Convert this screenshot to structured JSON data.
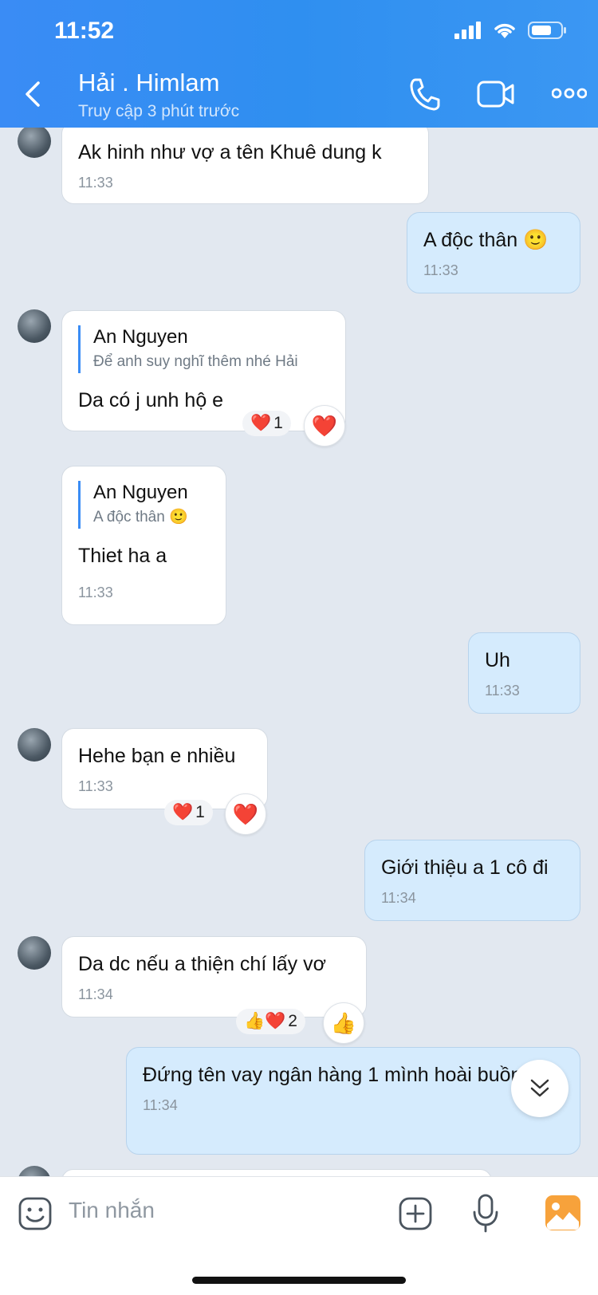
{
  "status": {
    "time": "11:52"
  },
  "header": {
    "title": "Hải . Himlam",
    "subtitle": "Truy cập 3 phút trước"
  },
  "messages": [
    {
      "text": "Ak hinh như vợ a tên Khuê dung k",
      "time": "11:33"
    },
    {
      "text": "A độc thân",
      "time": "11:33",
      "emoji": "🙂"
    },
    {
      "quote_name": "An Nguyen",
      "quote_text": "Để anh suy nghĩ thêm nhé Hải",
      "text": "Da có j unh hộ e",
      "reaction_count": "1",
      "reaction": "❤️"
    },
    {
      "quote_name": "An Nguyen",
      "quote_text": "A độc thân",
      "quote_emoji": "🙂",
      "text": "Thiet ha a",
      "time": "11:33"
    },
    {
      "text": "Uh",
      "time": "11:33"
    },
    {
      "text": "Hehe bạn e nhiều",
      "time": "11:33",
      "reaction_count": "1",
      "reaction": "❤️"
    },
    {
      "text": "Giới thiệu a 1 cô đi",
      "time": "11:34"
    },
    {
      "text": "Da dc nếu a thiện chí lấy vơ",
      "time": "11:34",
      "reaction_count": "2",
      "reaction_pill": "👍❤️",
      "reaction": "👍"
    },
    {
      "text": "Đứng tên vay ngân hàng 1 mình hoài buồn quá",
      "time": "11:34"
    }
  ],
  "input": {
    "placeholder": "Tin nhắn"
  },
  "icons": [
    "back-icon",
    "phone-icon",
    "video-call-icon",
    "more-icon",
    "sticker-icon",
    "add-icon",
    "microphone-icon",
    "image-icon",
    "scroll-down-icon",
    "avatar"
  ],
  "colors": {
    "header": "#3a8cf5",
    "outgoing_bubble": "#d5ebfd",
    "incoming_bubble": "#ffffff",
    "chat_bg": "#e2e8f0"
  }
}
